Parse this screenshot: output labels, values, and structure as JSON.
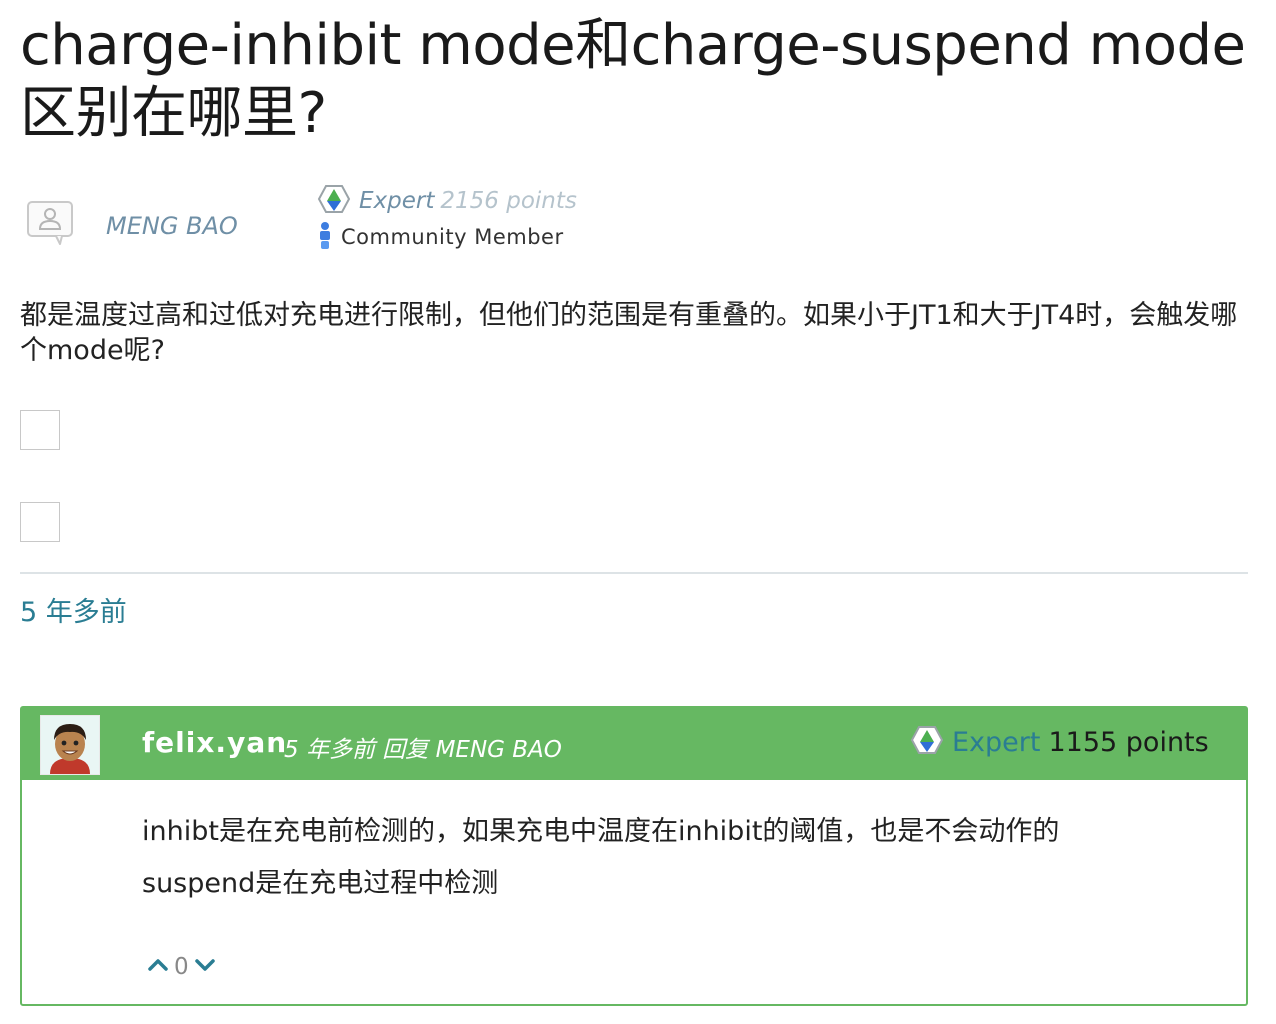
{
  "question": {
    "title": "charge-inhibit mode和charge-suspend mode区别在哪里?",
    "author": {
      "name": "MENG BAO",
      "avatar_icon": "user-placeholder-icon"
    },
    "rank": {
      "level": "Expert",
      "points": "2156 points",
      "badge_icon": "expert-badge-icon",
      "role": "Community Member",
      "role_icon": "community-member-icon"
    },
    "body": "都是温度过高和过低对充电进行限制，但他们的范围是有重叠的。如果小于JT1和大于JT4时，会触发哪个mode呢?",
    "timestamp": "5 年多前"
  },
  "reply": {
    "user": "felix.yan",
    "meta": "5 年多前 回复 MENG BAO",
    "rank_level": "Expert",
    "rank_points": "1155 points",
    "body_line1": "inhibt是在充电前检测的，如果充电中温度在inhibit的阈值，也是不会动作的",
    "body_line2": "suspend是在充电过程中检测",
    "vote_count": "0"
  },
  "colors": {
    "accent_green": "#66b862",
    "link_teal": "#2a7d93",
    "muted_blue": "#6f8fa6"
  }
}
